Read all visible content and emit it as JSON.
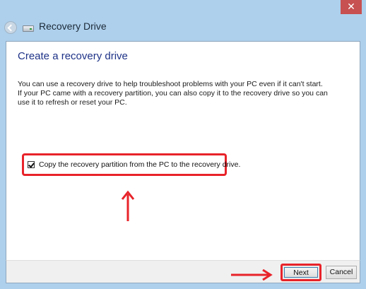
{
  "window": {
    "title": "Recovery Drive",
    "close_glyph": "✕"
  },
  "page": {
    "heading": "Create a recovery drive",
    "description": "You can use a recovery drive to help troubleshoot problems with your PC even if it can't start. If your PC came with a recovery partition, you can also copy it to the recovery drive so you can use it to refresh or reset your PC."
  },
  "option": {
    "label": "Copy the recovery partition from the PC to the recovery drive.",
    "checked": true
  },
  "footer": {
    "next_label": "Next",
    "cancel_label": "Cancel"
  },
  "icons": {
    "back": "back-arrow-icon",
    "drive": "drive-icon",
    "close": "close-icon"
  },
  "colors": {
    "frame": "#aed0ec",
    "heading": "#1e3287",
    "annotation": "#e8232a",
    "close_button": "#c75050"
  }
}
